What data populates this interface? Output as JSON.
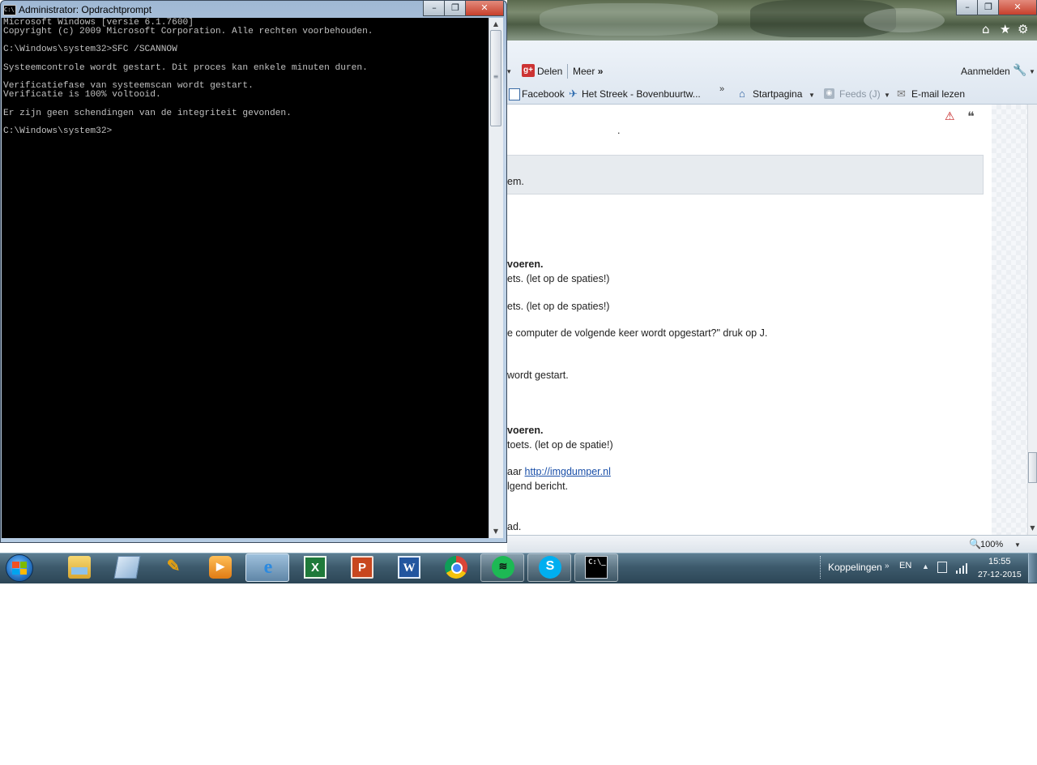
{
  "cmd": {
    "title": "Administrator: Opdrachtprompt",
    "icon_text": "C:\\",
    "lines": [
      "Microsoft Windows [versie 6.1.7600]",
      "Copyright (c) 2009 Microsoft Corporation. Alle rechten voorbehouden.",
      "",
      "C:\\Windows\\system32>SFC /SCANNOW",
      "",
      "Systeemcontrole wordt gestart. Dit proces kan enkele minuten duren.",
      "",
      "Verificatiefase van systeemscan wordt gestart.",
      "Verificatie is 100% voltooid.",
      "",
      "Er zijn geen schendingen van de integriteit gevonden.",
      "",
      "C:\\Windows\\system32>"
    ]
  },
  "ie": {
    "command_bar": {
      "delen": "Delen",
      "meer": "Meer",
      "meer_chevron": "»",
      "aanmelden": "Aanmelden"
    },
    "favorites": {
      "facebook": "Facebook",
      "streek": "Het Streek - Bovenbuurtw...",
      "startpagina": "Startpagina",
      "feeds": "Feeds (J)",
      "email": "E-mail lezen"
    },
    "content": {
      "dot": ".",
      "box_text": "em.",
      "lines": [
        {
          "text": "voeren.",
          "bold": true
        },
        {
          "text": "ets. (let op de spaties!)",
          "bold": false
        },
        {
          "text": "ets. (let op de spaties!)",
          "bold": false
        },
        {
          "text": "e computer de volgende keer wordt opgestart?\" druk op J.",
          "bold": false
        },
        {
          "text": "wordt gestart.",
          "bold": false
        },
        {
          "text": "voeren.",
          "bold": true
        },
        {
          "text": "toets. (let op de spatie!)",
          "bold": false
        }
      ],
      "link_prefix": "aar ",
      "link_text": "http://imgdumper.nl",
      "after_link": "lgend bericht.",
      "last": "ad."
    },
    "status": {
      "zoom": "100%"
    }
  },
  "taskbar": {
    "apps": [
      {
        "name": "explorer",
        "state": "pinned"
      },
      {
        "name": "notepad",
        "state": "pinned"
      },
      {
        "name": "paint",
        "state": "pinned"
      },
      {
        "name": "media-player",
        "state": "pinned"
      },
      {
        "name": "internet-explorer",
        "state": "active"
      },
      {
        "name": "excel",
        "state": "pinned"
      },
      {
        "name": "powerpoint",
        "state": "pinned"
      },
      {
        "name": "word",
        "state": "pinned"
      },
      {
        "name": "chrome",
        "state": "pinned"
      },
      {
        "name": "spotify",
        "state": "open"
      },
      {
        "name": "skype",
        "state": "open"
      },
      {
        "name": "command-prompt",
        "state": "open"
      }
    ],
    "labels": {
      "excel": "X",
      "powerpoint": "P",
      "word": "W",
      "skype": "S",
      "cmd": "C:\\_"
    },
    "tray": {
      "koppelingen": "Koppelingen",
      "language": "EN",
      "time": "15:55",
      "date": "27-12-2015"
    }
  },
  "colors": {
    "console_bg": "#000000",
    "console_text": "#c0c0c0",
    "link": "#1a4fa8",
    "taskbar": "#3d5a6c"
  }
}
